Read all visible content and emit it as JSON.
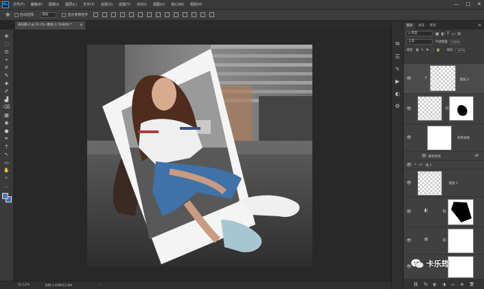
{
  "menu": {
    "logo": "Ps",
    "items": [
      "文件(F)",
      "编辑(E)",
      "图像(I)",
      "图层(L)",
      "文字(Y)",
      "选择(S)",
      "滤镜(T)",
      "3D(D)",
      "视图(V)",
      "窗口(W)",
      "帮助(H)"
    ],
    "window_controls": [
      "—",
      "□",
      "✕"
    ]
  },
  "options": {
    "move_glyph": "✥",
    "auto_select_label": "自动选择:",
    "auto_select_value": "图层",
    "transform_label": "显示变换控件"
  },
  "document": {
    "tab_title": "未标题-4 @ 52.1% (图层 2, RGB/8) *",
    "close": "×"
  },
  "tools": [
    "✥",
    "⬚",
    "ʘ",
    "⌖",
    "⧄",
    "✎",
    "✚",
    "✐",
    "▟",
    "⌫",
    "▦",
    "◉",
    "●",
    "✒",
    "T",
    "↖",
    "▭",
    "✋",
    "⌕",
    "…"
  ],
  "status": {
    "zoom": "52.12%",
    "doc_info": "文档:4.69M/15.6M",
    "arrow": "›"
  },
  "layers_panel": {
    "tabs": [
      "图层",
      "通道",
      "路径"
    ],
    "menu_glyph": "≡",
    "filter_label": "ρ 类型",
    "blend_mode": "正常",
    "opacity_label": "不透明度:",
    "opacity_value": "100%",
    "lock_label": "锁定:",
    "fill_label": "填充:",
    "fill_value": "100%",
    "eye": "👁",
    "layers": [
      {
        "name": "图层 2"
      },
      {
        "name": ""
      },
      {
        "name": "背景透视"
      },
      {
        "name": "颜色杂色"
      },
      {
        "name": "组 1"
      },
      {
        "name": "图层 1"
      },
      {
        "name": ""
      },
      {
        "name": ""
      },
      {
        "name": ""
      }
    ],
    "footer_icons": [
      "⛓",
      "fx",
      "◐",
      "◑",
      "▭",
      "⊕",
      "🗑"
    ]
  },
  "watermark": {
    "text": "卡乐筠"
  }
}
